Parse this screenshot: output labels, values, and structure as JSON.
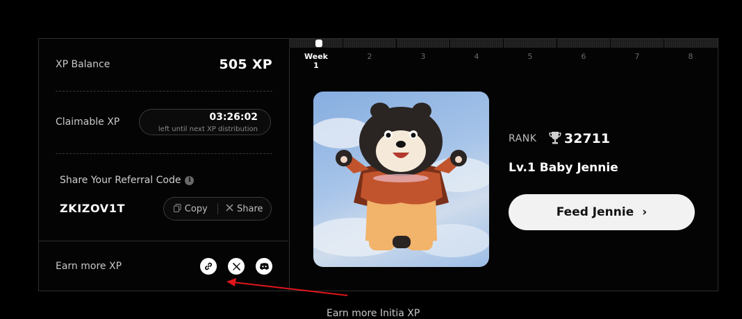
{
  "xp": {
    "balance_label": "XP Balance",
    "balance_value": "505 XP",
    "claimable_label": "Claimable XP",
    "countdown": "03:26:02",
    "countdown_note": "left until next XP distribution"
  },
  "referral": {
    "title": "Share Your Referral Code",
    "info_glyph": "i",
    "code": "ZKIZOV1T",
    "copy_label": "Copy",
    "share_label": "Share"
  },
  "earn": {
    "label": "Earn more XP",
    "icons": [
      "link-icon",
      "x-icon",
      "discord-icon"
    ]
  },
  "weeks": {
    "labels": [
      "Week 1",
      "2",
      "3",
      "4",
      "5",
      "6",
      "7",
      "8"
    ],
    "current_index": 0
  },
  "pet": {
    "rank_label": "RANK",
    "rank_value": "32711",
    "name": "Lv.1 Baby Jennie",
    "feed_label": "Feed Jennie",
    "feed_chevron": "›"
  },
  "caption": "Earn more Initia XP",
  "colors": {
    "annotation_arrow": "#e0161b",
    "background": "#000000",
    "button_bg": "#f2f2f2"
  }
}
